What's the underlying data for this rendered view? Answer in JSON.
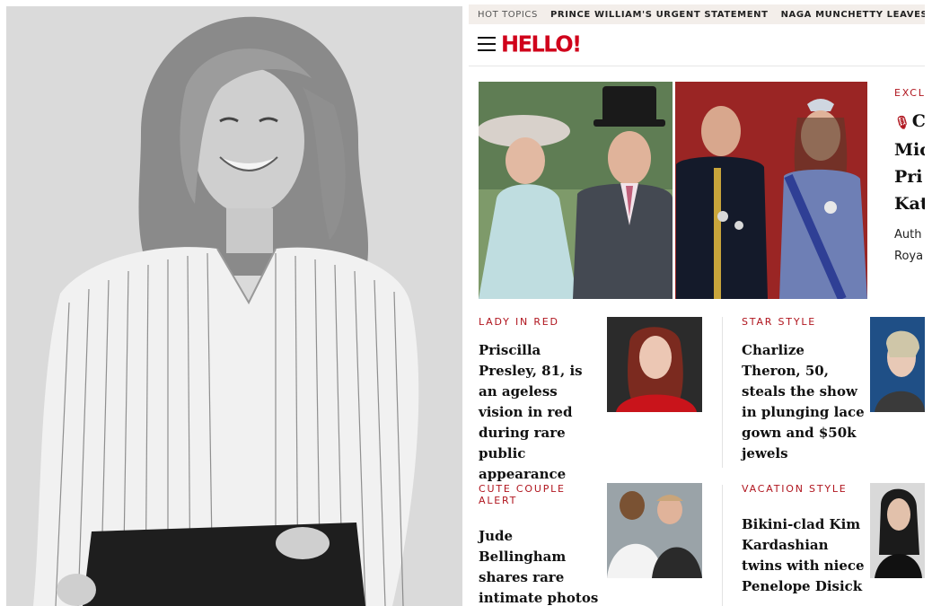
{
  "hot_topics": {
    "label": "HOT TOPICS",
    "links": [
      "PRINCE WILLIAM'S URGENT STATEMENT",
      "NAGA MUNCHETTY LEAVES BBC B"
    ]
  },
  "header": {
    "logo": "HELLO!",
    "menu_icon": "hamburger-menu-icon"
  },
  "hero": {
    "eyebrow": "EXCL",
    "headline_first": "C",
    "headline_rest": "Mic\nPri\nKat",
    "author": "Auth\nRoya"
  },
  "cards": [
    {
      "eyebrow": "LADY IN RED",
      "title": "Priscilla Presley, 81, is an ageless vision in red during rare public appearance"
    },
    {
      "eyebrow": "STAR STYLE",
      "title": "Charlize Theron, 50, steals the show in plunging lace gown and $50k jewels"
    },
    {
      "eyebrow": "CUTE COUPLE ALERT",
      "title": "Jude Bellingham shares rare intimate photos with girlfriend"
    },
    {
      "eyebrow": "VACATION STYLE",
      "title": "Bikini-clad Kim Kardashian twins with niece Penelope Disick"
    }
  ],
  "colors": {
    "brand_red": "#d0021b",
    "eyebrow_red": "#b0151e",
    "hot_topics_bg": "#f3eeea"
  }
}
